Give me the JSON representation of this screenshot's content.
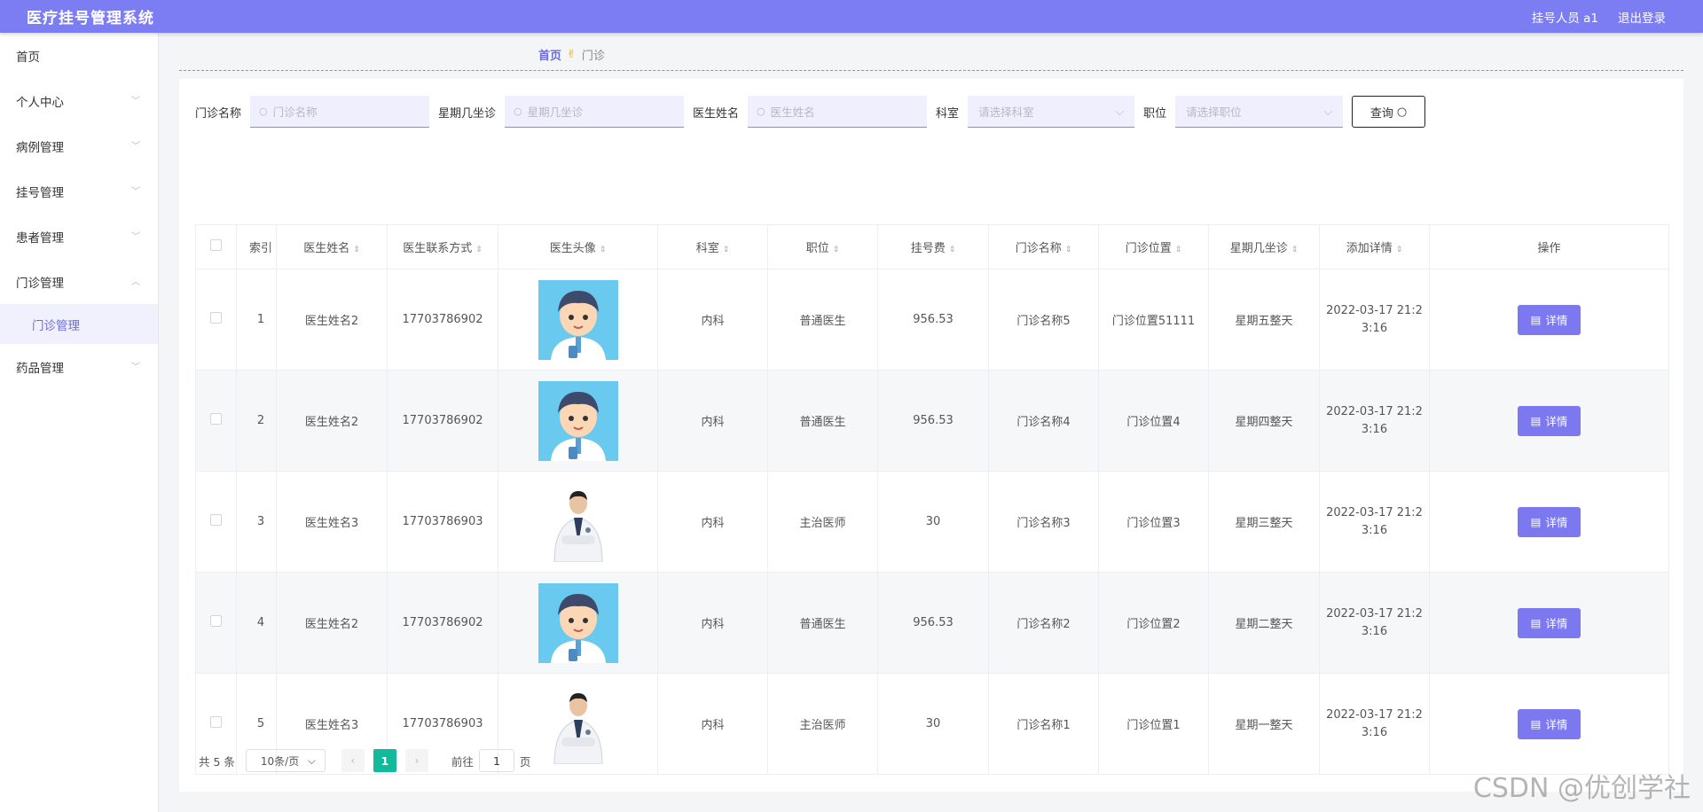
{
  "header": {
    "title": "医疗挂号管理系统",
    "user_label": "挂号人员 a1",
    "logout_label": "退出登录",
    "accent_color": "#7c7cf3"
  },
  "sidebar": {
    "items": [
      {
        "label": "首页"
      },
      {
        "label": "个人中心"
      },
      {
        "label": "病例管理"
      },
      {
        "label": "挂号管理"
      },
      {
        "label": "患者管理"
      },
      {
        "label": "门诊管理"
      },
      {
        "label": "药品管理"
      }
    ],
    "active_sub": "门诊管理"
  },
  "breadcrumb": {
    "home": "首页",
    "current": "门诊"
  },
  "search": {
    "clinic_label": "门诊名称",
    "clinic_placeholder": "门诊名称",
    "weekday_label": "星期几坐诊",
    "weekday_placeholder": "星期几坐诊",
    "doctor_label": "医生姓名",
    "doctor_placeholder": "医生姓名",
    "dept_label": "科室",
    "dept_placeholder": "请选择科室",
    "title_label": "职位",
    "title_placeholder": "请选择职位",
    "query_label": "查询"
  },
  "table": {
    "columns": [
      "索引",
      "医生姓名",
      "医生联系方式",
      "医生头像",
      "科室",
      "职位",
      "挂号费",
      "门诊名称",
      "门诊位置",
      "星期几坐诊",
      "添加详情",
      "操作"
    ],
    "rows": [
      {
        "index": "1",
        "name": "医生姓名2",
        "phone": "17703786902",
        "avatar": "cartoon",
        "dept": "内科",
        "title": "普通医生",
        "fee": "956.53",
        "clinic": "门诊名称5",
        "location": "门诊位置51111",
        "weekday": "星期五整天",
        "date": "2022-03-17 21:23:16",
        "action": "详情"
      },
      {
        "index": "2",
        "name": "医生姓名2",
        "phone": "17703786902",
        "avatar": "cartoon",
        "dept": "内科",
        "title": "普通医生",
        "fee": "956.53",
        "clinic": "门诊名称4",
        "location": "门诊位置4",
        "weekday": "星期四整天",
        "date": "2022-03-17 21:23:16",
        "action": "详情"
      },
      {
        "index": "3",
        "name": "医生姓名3",
        "phone": "17703786903",
        "avatar": "photo",
        "dept": "内科",
        "title": "主治医师",
        "fee": "30",
        "clinic": "门诊名称3",
        "location": "门诊位置3",
        "weekday": "星期三整天",
        "date": "2022-03-17 21:23:16",
        "action": "详情"
      },
      {
        "index": "4",
        "name": "医生姓名2",
        "phone": "17703786902",
        "avatar": "cartoon",
        "dept": "内科",
        "title": "普通医生",
        "fee": "956.53",
        "clinic": "门诊名称2",
        "location": "门诊位置2",
        "weekday": "星期二整天",
        "date": "2022-03-17 21:23:16",
        "action": "详情"
      },
      {
        "index": "5",
        "name": "医生姓名3",
        "phone": "17703786903",
        "avatar": "photo",
        "dept": "内科",
        "title": "主治医师",
        "fee": "30",
        "clinic": "门诊名称1",
        "location": "门诊位置1",
        "weekday": "星期一整天",
        "date": "2022-03-17 21:23:16",
        "action": "详情"
      }
    ]
  },
  "pagination": {
    "total": "共 5 条",
    "page_size": "10条/页",
    "current_page": "1",
    "goto_prefix": "前往",
    "goto_value": "1",
    "goto_suffix": "页"
  },
  "watermark": "CSDN @优创学社"
}
